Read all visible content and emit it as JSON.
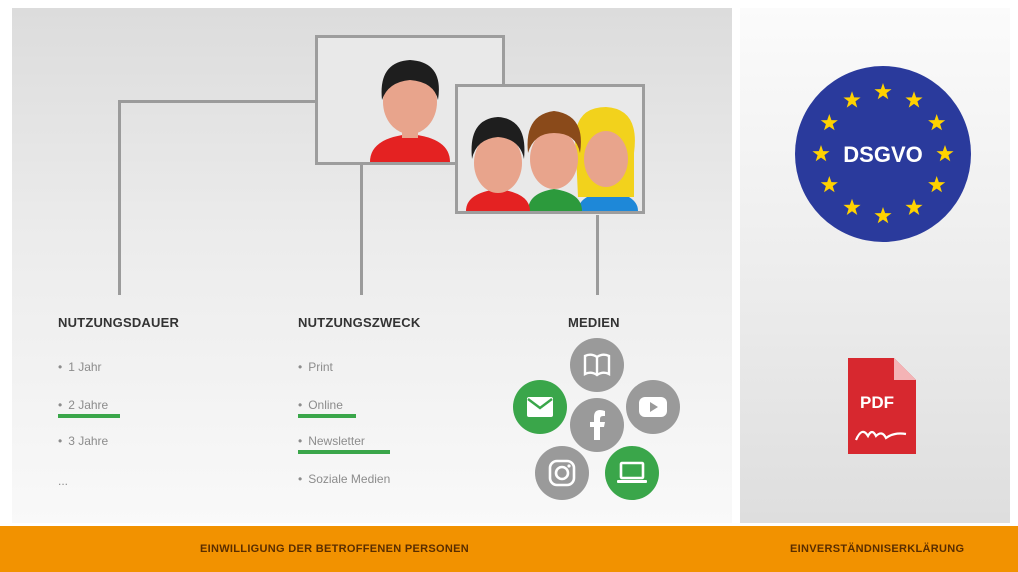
{
  "columns": {
    "nutzungsdauer": {
      "heading": "NUTZUNGSDAUER",
      "items": [
        "1 Jahr",
        "2 Jahre",
        "3 Jahre",
        "..."
      ],
      "selected": [
        "2 Jahre"
      ]
    },
    "nutzungszweck": {
      "heading": "NUTZUNGSZWECK",
      "items": [
        "Print",
        "Online",
        "Newsletter",
        "Soziale Medien"
      ],
      "selected": [
        "Online",
        "Newsletter"
      ]
    },
    "medien": {
      "heading": "MEDIEN",
      "icons": [
        {
          "name": "book-icon",
          "state": "inactive"
        },
        {
          "name": "mail-icon",
          "state": "active"
        },
        {
          "name": "facebook-icon",
          "state": "inactive"
        },
        {
          "name": "youtube-icon",
          "state": "inactive"
        },
        {
          "name": "instagram-icon",
          "state": "inactive"
        },
        {
          "name": "laptop-icon",
          "state": "active"
        }
      ]
    }
  },
  "badges": {
    "dsgvo": "DSGVO",
    "pdf": "PDF"
  },
  "footer": {
    "left": "EINWILLIGUNG DER BETROFFENEN PERSONEN",
    "right": "EINVERSTÄNDNISERKLÄRUNG"
  },
  "colors": {
    "accent_green": "#3aa64a",
    "footer_orange": "#f29200",
    "eu_blue": "#2a3a9c",
    "eu_star": "#ffd200",
    "pdf_red": "#d7282f"
  }
}
